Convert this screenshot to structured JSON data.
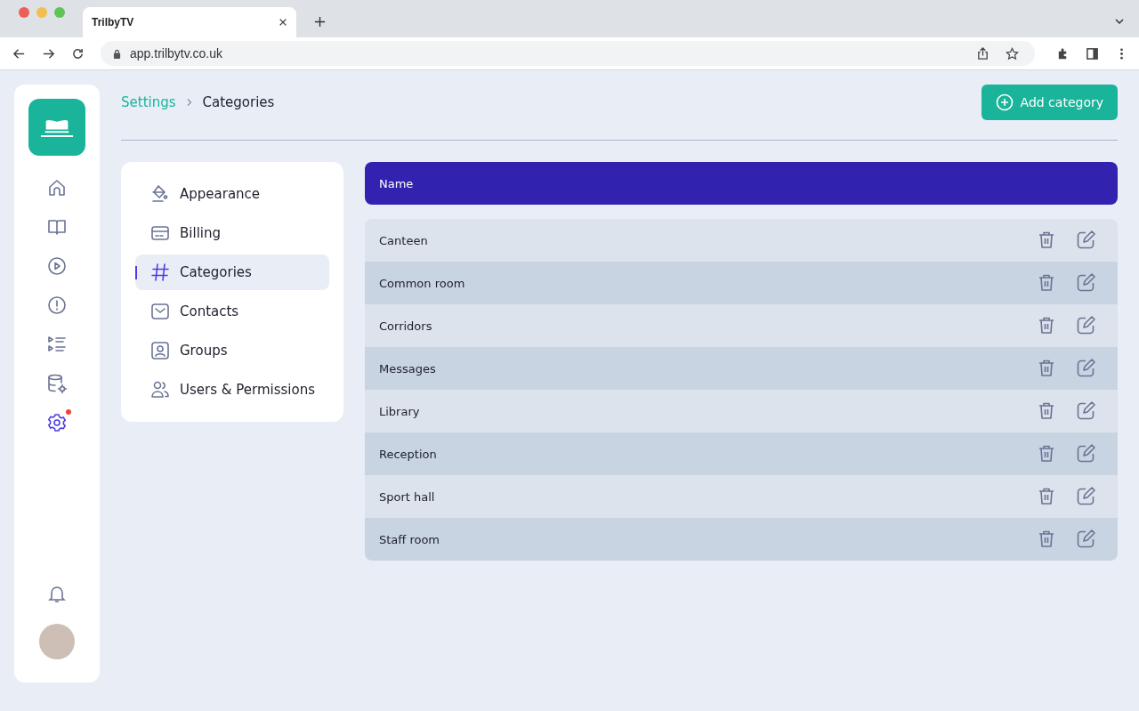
{
  "browser": {
    "tab_title": "TrilbyTV",
    "url": "app.trilbytv.co.uk"
  },
  "rail": {
    "items": [
      {
        "kind": "home",
        "selected": false,
        "badge": false
      },
      {
        "kind": "book",
        "selected": false,
        "badge": false
      },
      {
        "kind": "play",
        "selected": false,
        "badge": false
      },
      {
        "kind": "alert",
        "selected": false,
        "badge": false
      },
      {
        "kind": "playlist",
        "selected": false,
        "badge": false
      },
      {
        "kind": "database",
        "selected": false,
        "badge": false
      },
      {
        "kind": "settings",
        "selected": true,
        "badge": true
      }
    ]
  },
  "breadcrumb": [
    {
      "label": "Settings",
      "link": true
    },
    {
      "label": "Categories",
      "link": false
    }
  ],
  "add_button": {
    "label": "Add category"
  },
  "settings_menu": [
    {
      "kind": "paint",
      "label": "Appearance",
      "selected": false
    },
    {
      "kind": "card",
      "label": "Billing",
      "selected": false
    },
    {
      "kind": "hash",
      "label": "Categories",
      "selected": true
    },
    {
      "kind": "mail",
      "label": "Contacts",
      "selected": false
    },
    {
      "kind": "person",
      "label": "Groups",
      "selected": false
    },
    {
      "kind": "users",
      "label": "Users & Permissions",
      "selected": false
    }
  ],
  "table": {
    "columns": [
      "Name"
    ],
    "rows": [
      {
        "name": "Canteen"
      },
      {
        "name": "Common room"
      },
      {
        "name": "Corridors"
      },
      {
        "name": "Messages"
      },
      {
        "name": "Library"
      },
      {
        "name": "Reception"
      },
      {
        "name": "Sport hall"
      },
      {
        "name": "Staff room"
      }
    ]
  }
}
